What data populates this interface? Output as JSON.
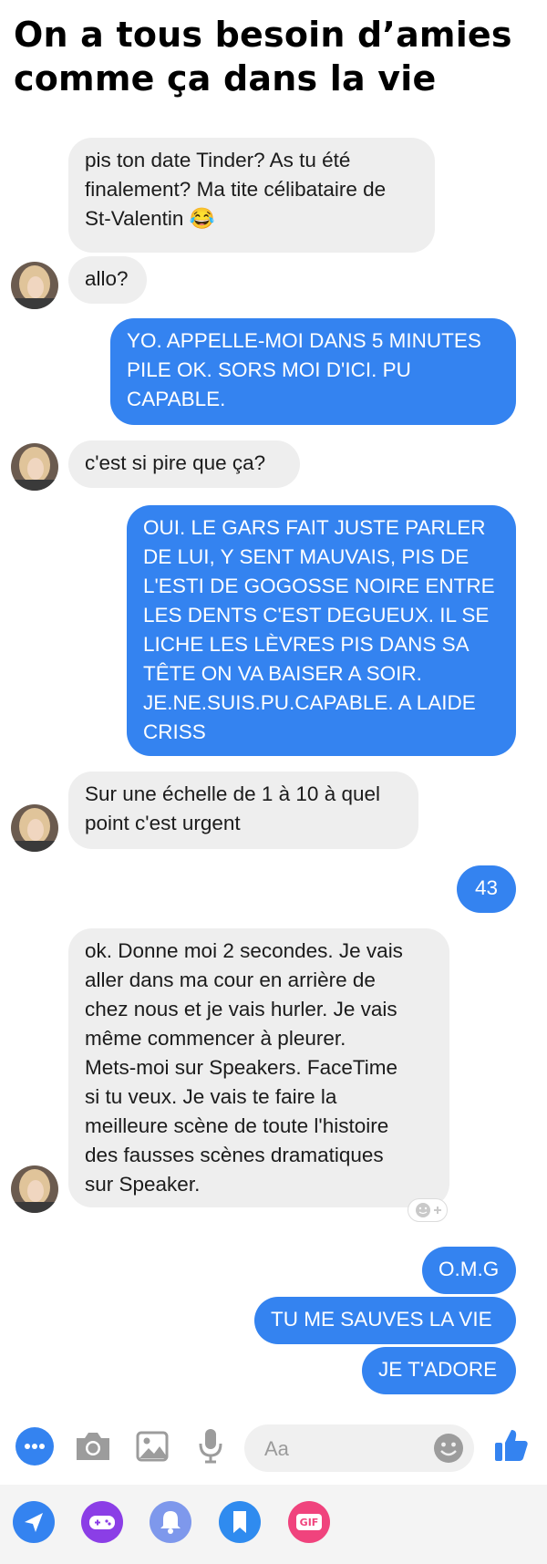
{
  "meme_title": {
    "line1": "On a tous besoin d’amies",
    "line2": "comme ça dans la vie"
  },
  "messages": [
    {
      "from": "friend",
      "text": "pis ton date Tinder? As tu été\nfinalement? Ma tite célibataire de\nSt-Valentin 😂"
    },
    {
      "from": "friend",
      "text": "allo?"
    },
    {
      "from": "me",
      "text": "YO. APPELLE-MOI DANS 5 MINUTES\nPILE OK. SORS MOI D'ICI. PU\nCAPABLE."
    },
    {
      "from": "friend",
      "text": "c'est si pire que ça?"
    },
    {
      "from": "me",
      "text": "OUI. LE GARS FAIT JUSTE PARLER\nDE LUI, Y SENT MAUVAIS, PIS DE\nL'ESTI DE GOGOSSE NOIRE ENTRE\nLES DENTS C'EST DEGUEUX. IL SE\nLICHE LES LÈVRES PIS DANS SA\nTÊTE ON VA BAISER A SOIR.\nJE.NE.SUIS.PU.CAPABLE. A LAIDE\nCRISS"
    },
    {
      "from": "friend",
      "text": "Sur une échelle de 1 à 10 à quel\npoint c'est urgent"
    },
    {
      "from": "me",
      "text": "43"
    },
    {
      "from": "friend",
      "text": "ok. Donne moi 2 secondes. Je vais\naller dans ma cour en arrière de\nchez nous et je vais hurler. Je vais\nmême commencer à pleurer.\nMets-moi sur Speakers. FaceTime\nsi tu veux. Je vais te faire la\nmeilleure scène de toute l'histoire\ndes fausses scènes dramatiques\nsur Speaker."
    },
    {
      "from": "me",
      "text": "O.M.G"
    },
    {
      "from": "me",
      "text": "TU ME SAUVES LA VIE"
    },
    {
      "from": "me",
      "text": "JE T'ADORE"
    }
  ],
  "composer": {
    "placeholder": "Aa",
    "icons": [
      "more-icon",
      "camera-icon",
      "image-icon",
      "microphone-icon",
      "emoji-icon",
      "thumbs-up-icon"
    ]
  },
  "app_tray": {
    "gif_label": "GIF",
    "icons": [
      "send-location-icon",
      "game-controller-icon",
      "bell-icon",
      "bookmark-icon",
      "gif-icon"
    ]
  },
  "colors": {
    "outgoing_bubble": "#3483f0",
    "incoming_bubble": "#eeeeee",
    "accent": "#3483f0"
  }
}
